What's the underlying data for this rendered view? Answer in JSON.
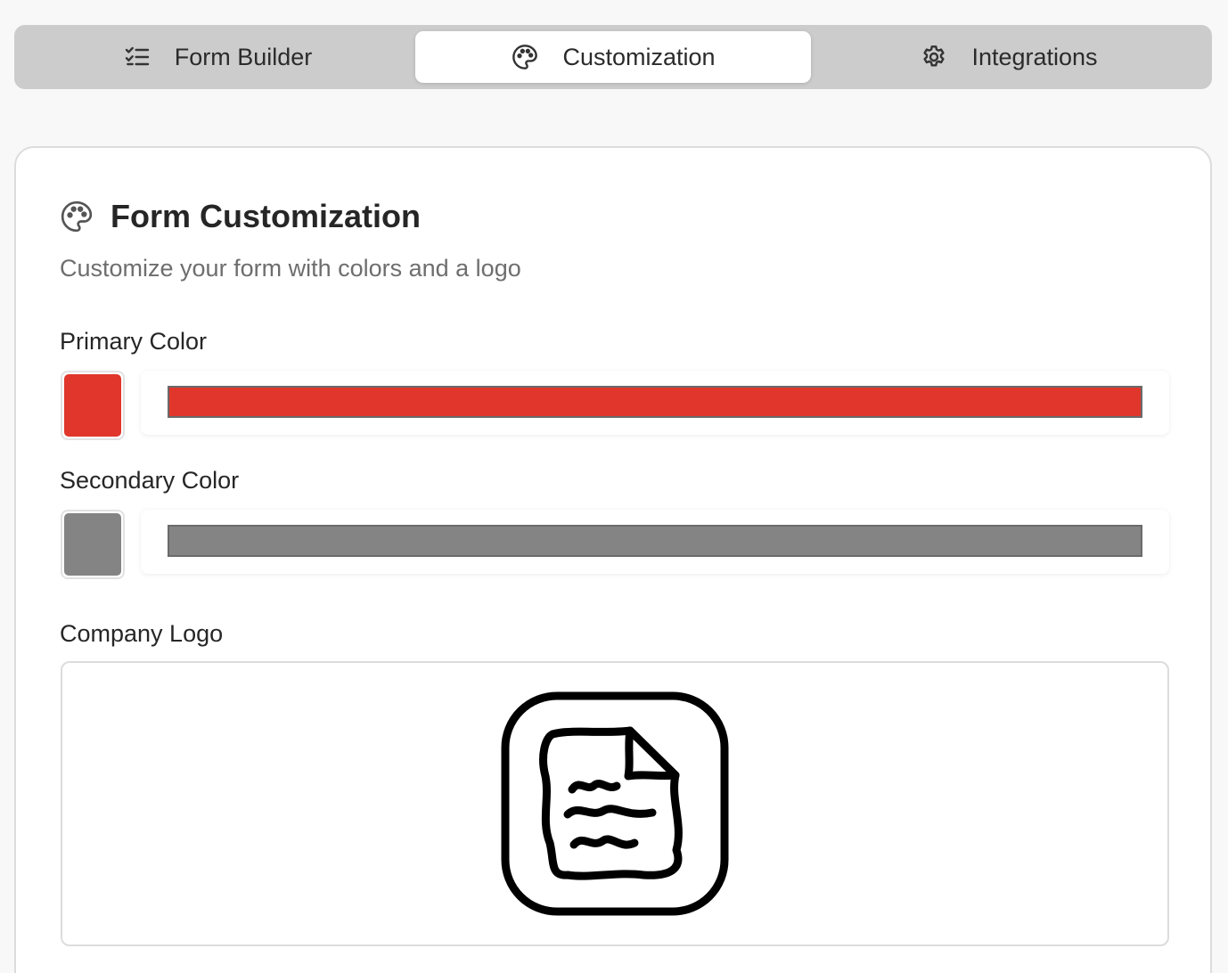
{
  "tabs": [
    {
      "label": "Form Builder",
      "icon": "checklist-icon",
      "active": false
    },
    {
      "label": "Customization",
      "icon": "palette-icon",
      "active": true
    },
    {
      "label": "Integrations",
      "icon": "gear-icon",
      "active": false
    }
  ],
  "card": {
    "title": "Form Customization",
    "subtitle": "Customize your form with colors and a logo"
  },
  "primary": {
    "label": "Primary Color",
    "color": "#e0362b"
  },
  "secondary": {
    "label": "Secondary Color",
    "color": "#848484"
  },
  "logo": {
    "label": "Company Logo",
    "icon": "document-logo-icon"
  }
}
